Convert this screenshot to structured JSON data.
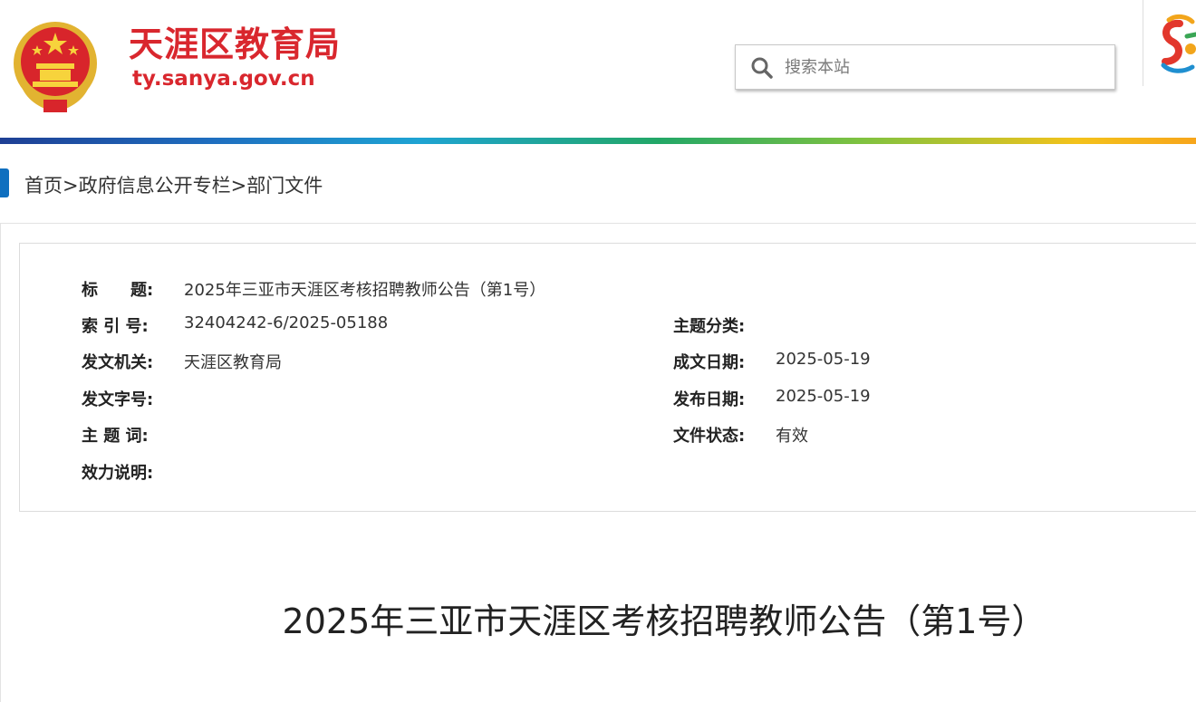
{
  "header": {
    "site_title": "天涯区教育局",
    "site_domain": "ty.sanya.gov.cn",
    "emblem_icon": "national-emblem-icon",
    "brand_color": "#d9272e"
  },
  "search": {
    "placeholder": "搜索本站",
    "icon": "search-icon"
  },
  "breadcrumb": {
    "home": "首页",
    "section": "政府信息公开专栏",
    "current": "部门文件",
    "separator": ">"
  },
  "meta": {
    "title_label": "标　　题:",
    "title_value": "2025年三亚市天涯区考核招聘教师公告（第1号）",
    "index_label": "索 引 号:",
    "index_value": "32404242-6/2025-05188",
    "topic_category_label": "主题分类:",
    "topic_category_value": "",
    "issuer_label": "发文机关:",
    "issuer_value": "天涯区教育局",
    "created_date_label": "成文日期:",
    "created_date_value": "2025-05-19",
    "doc_number_label": "发文字号:",
    "doc_number_value": "",
    "publish_date_label": "发布日期:",
    "publish_date_value": "2025-05-19",
    "keywords_label": "主 题 词:",
    "keywords_value": "",
    "status_label": "文件状态:",
    "status_value": "有效",
    "validity_label": "效力说明:",
    "validity_value": ""
  },
  "document": {
    "title": "2025年三亚市天涯区考核招聘教师公告（第1号）"
  }
}
